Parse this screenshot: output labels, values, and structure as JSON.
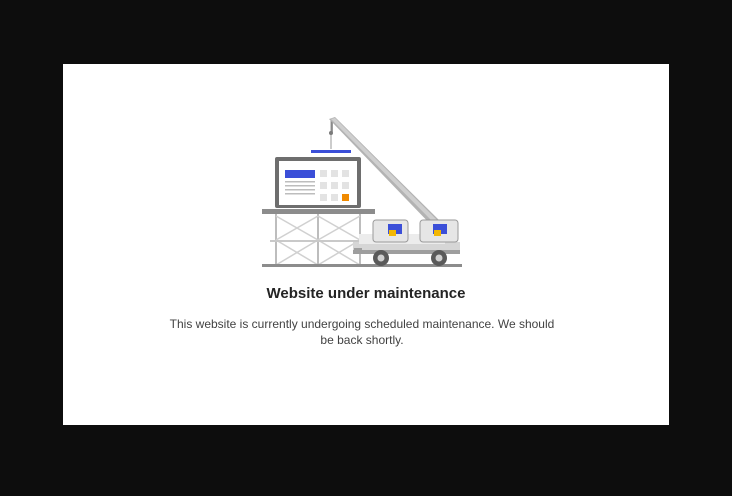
{
  "page": {
    "heading": "Website under maintenance",
    "message": "This website is currently undergoing scheduled maintenance. We should be back shortly."
  },
  "illustration": {
    "icon": "construction-crane-icon",
    "colors": {
      "accent_blue": "#3b4fd8",
      "accent_yellow": "#f2b705",
      "accent_orange": "#f08a00",
      "gray_dark": "#6e6e6e",
      "gray_mid": "#a8a8a8",
      "gray_light": "#e3e3e3"
    }
  },
  "theme": {
    "backdrop": "#0d0d0d",
    "card": "#ffffff",
    "text_primary": "#242424",
    "text_secondary": "#424242"
  }
}
